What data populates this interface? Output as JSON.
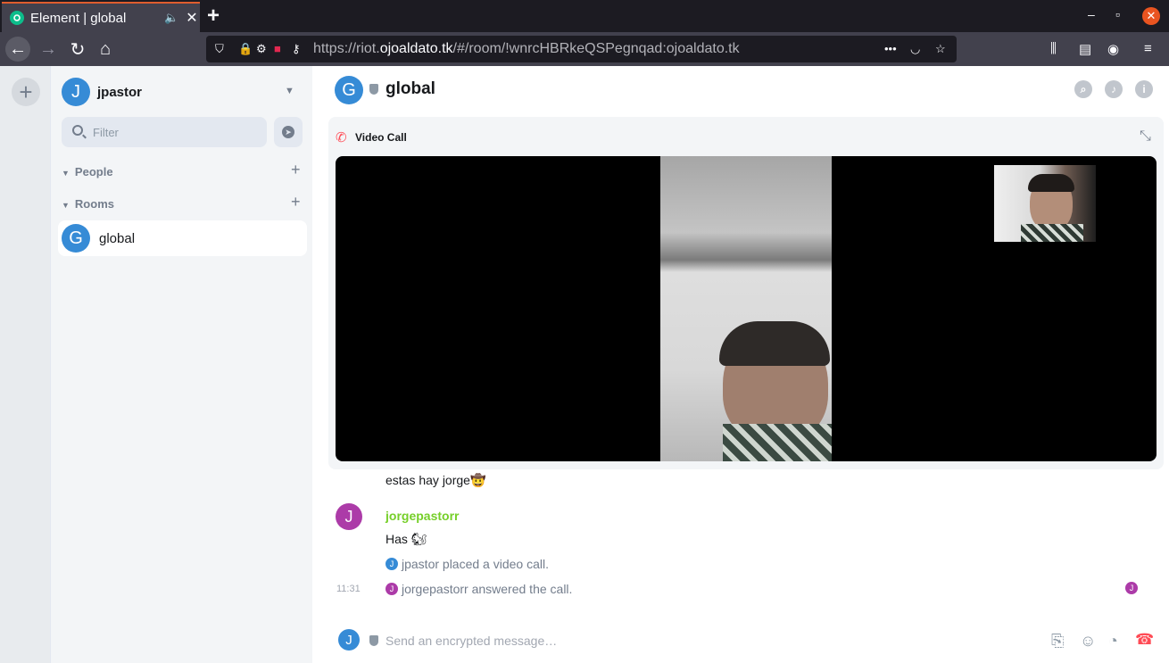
{
  "browser": {
    "tab_title": "Element | global",
    "tab_audio_icon": "speaker-icon",
    "url_prefix": "https://riot.",
    "url_domain": "ojoaldato.tk",
    "url_path": "/#/room/!wnrcHBRkeQSPegnqad:ojoaldato.tk",
    "url_more": "•••"
  },
  "user": {
    "avatar_letter": "J",
    "name": "jpastor"
  },
  "sidebar": {
    "filter_placeholder": "Filter",
    "sections": [
      {
        "label": "People"
      },
      {
        "label": "Rooms"
      }
    ],
    "rooms": [
      {
        "avatar_letter": "G",
        "name": "global"
      }
    ]
  },
  "room": {
    "avatar_letter": "G",
    "title": "global"
  },
  "call": {
    "label": "Video Call"
  },
  "timeline": {
    "first_message": "estas hay jorge🤠",
    "sender": {
      "avatar_letter": "J",
      "name": "jorgepastorr"
    },
    "sender_message": "Has 🐿",
    "events": [
      {
        "avatar_letter": "J",
        "text": "jpastor placed a video call."
      },
      {
        "avatar_letter": "J",
        "text": "jorgepastorr answered the call."
      }
    ],
    "timestamp": "11:31",
    "receipt_letter": "J"
  },
  "composer": {
    "avatar_letter": "J",
    "placeholder": "Send an encrypted message…"
  },
  "colors": {
    "accent_green": "#0dbd8b",
    "sender_green": "#76cf29",
    "avatar_blue": "#368bd6",
    "avatar_purple": "#ac3ba8",
    "hangup_red": "#ff4b55"
  }
}
